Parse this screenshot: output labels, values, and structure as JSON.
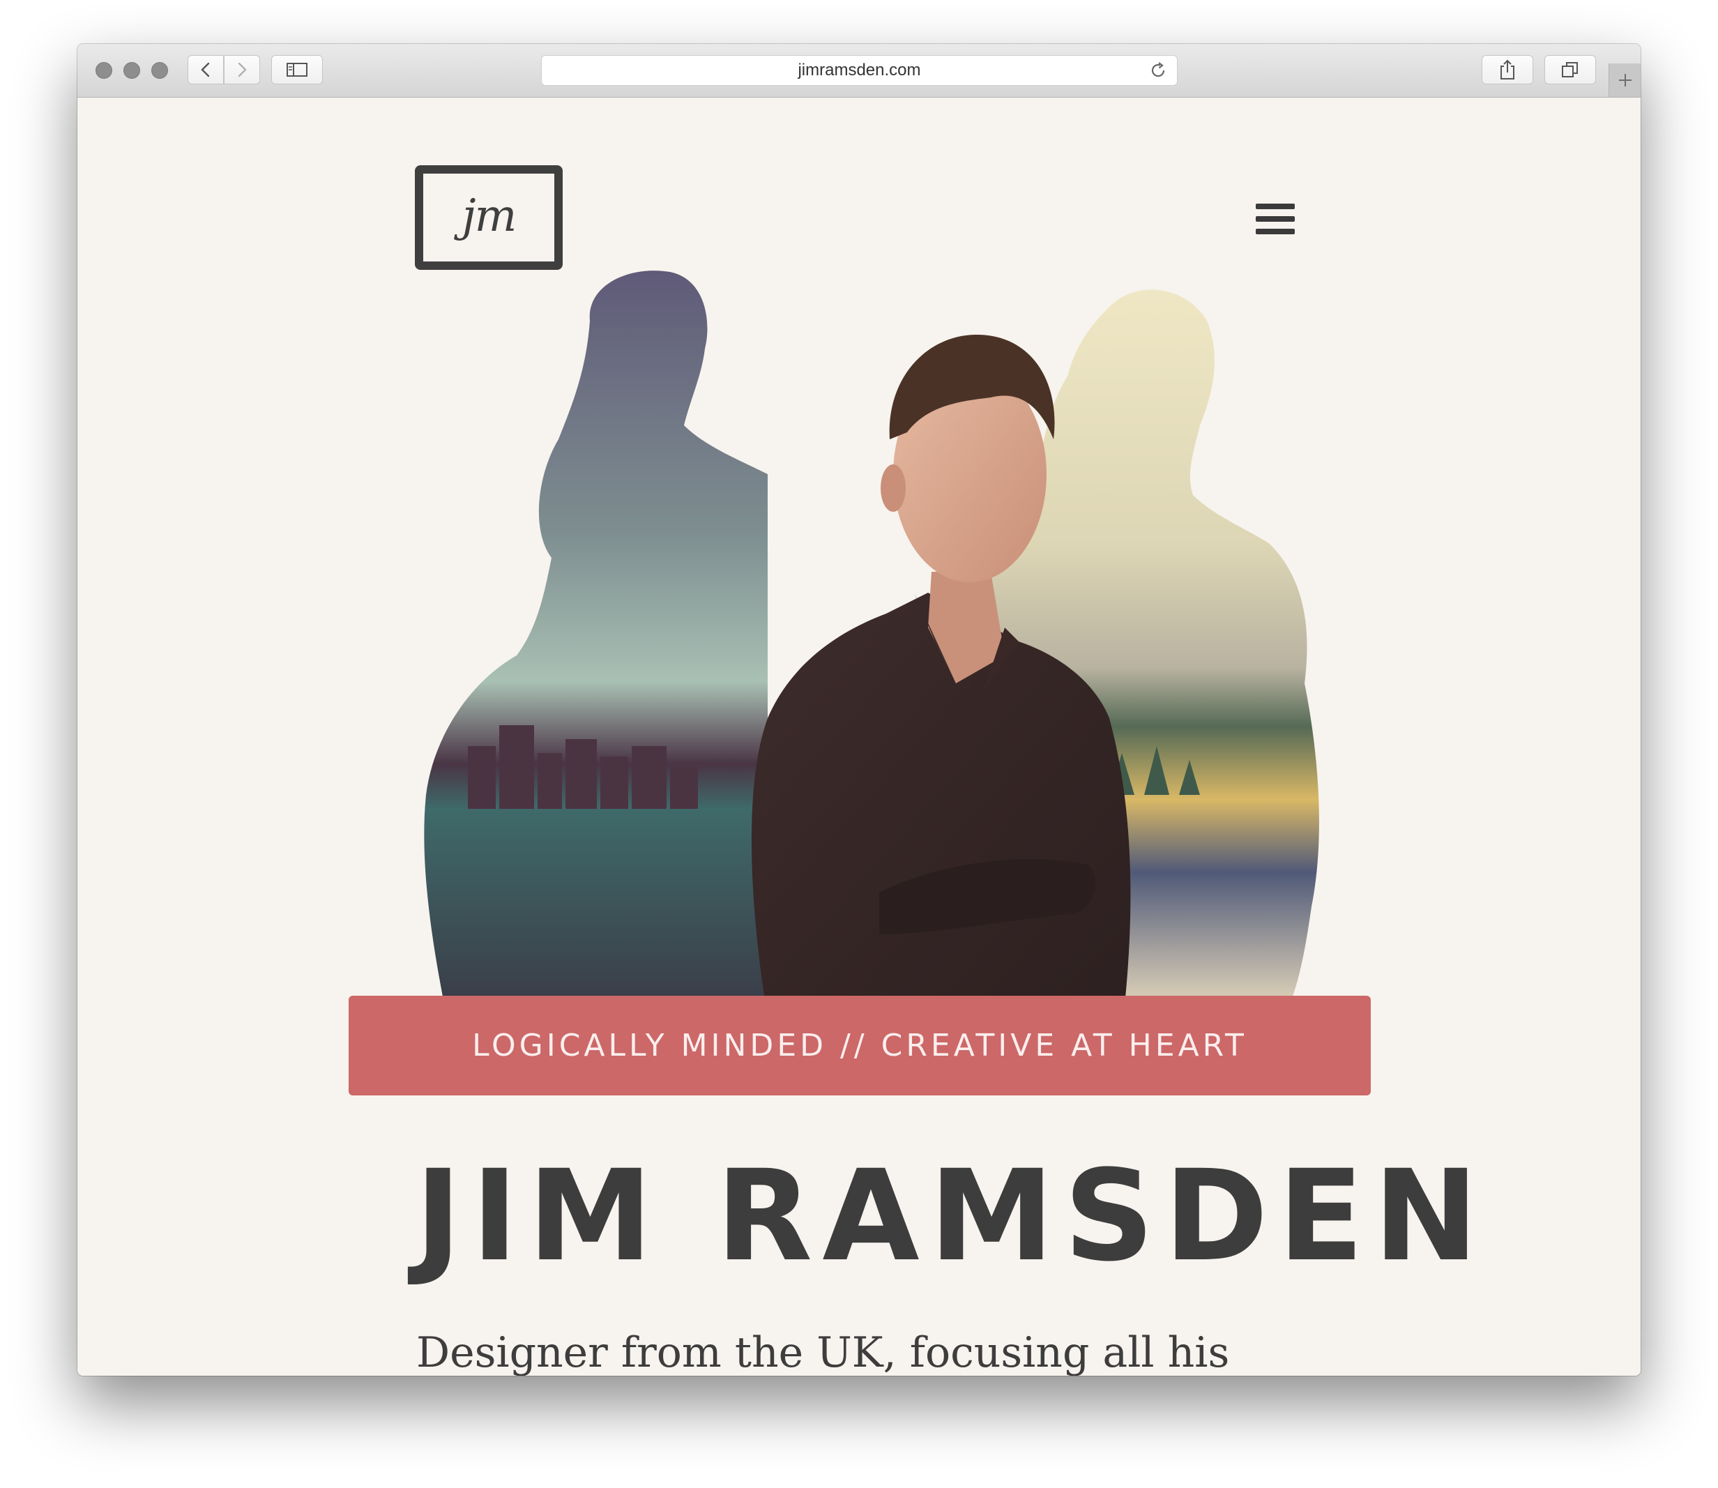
{
  "browser": {
    "url": "jimramsden.com"
  },
  "header": {
    "logo_text": "jm"
  },
  "hero": {
    "tagline": "LOGICALLY MINDED // CREATIVE AT HEART",
    "name": "JIM RAMSDEN",
    "intro": "Designer from the UK, focusing all his"
  },
  "colors": {
    "page_background": "#f7f3ee",
    "banner": "#cc6868",
    "text_dark": "#3d3d3d"
  }
}
